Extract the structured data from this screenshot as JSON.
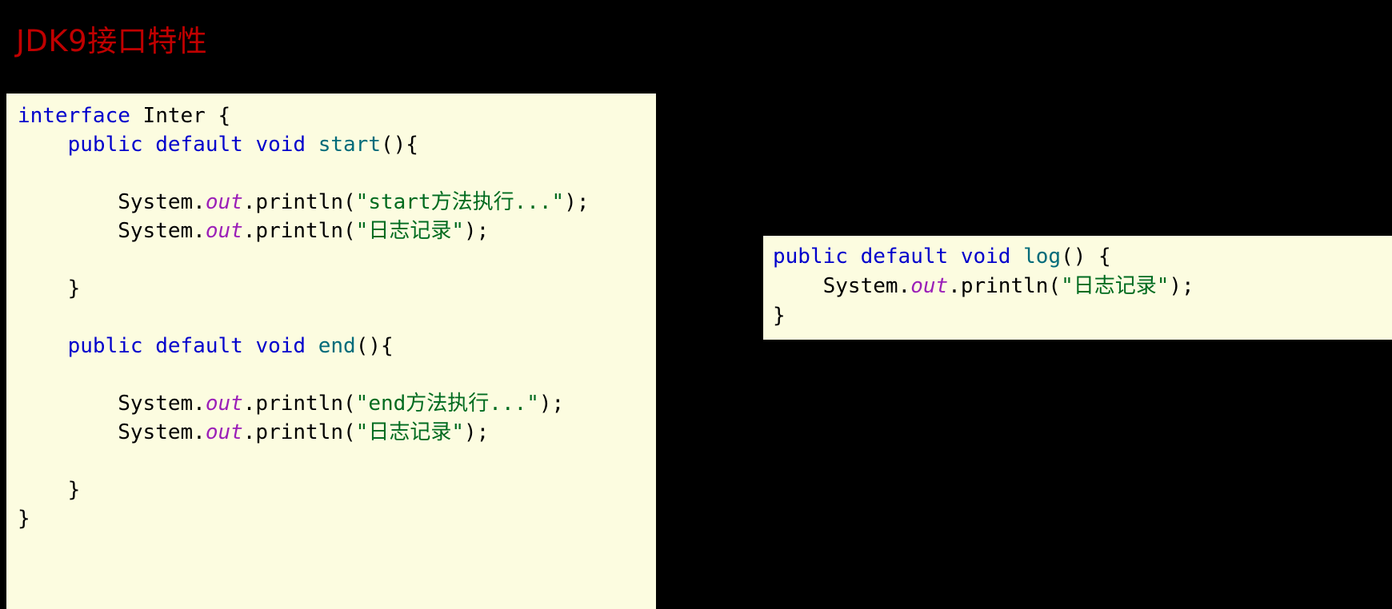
{
  "slide": {
    "title": "JDK9接口特性",
    "title_color": "#C00000",
    "background_color": "#000000"
  },
  "theme": {
    "code_background": "#FCFCE0",
    "keyword_color": "#0000CC",
    "method_color": "#006B7A",
    "field_color": "#9B1FB8",
    "string_color": "#006B1F",
    "plain_color": "#000000"
  },
  "code_main": {
    "name": "interface-inter-code-block",
    "lines": [
      {
        "id": "m1",
        "tokens": [
          {
            "t": "interface",
            "k": "kw"
          },
          {
            "t": " ",
            "k": "plain"
          },
          {
            "t": "Inter",
            "k": "plain"
          },
          {
            "t": " {",
            "k": "plain"
          }
        ]
      },
      {
        "id": "m2",
        "tokens": [
          {
            "t": "    ",
            "k": "plain"
          },
          {
            "t": "public",
            "k": "kw"
          },
          {
            "t": " ",
            "k": "plain"
          },
          {
            "t": "default",
            "k": "kw"
          },
          {
            "t": " ",
            "k": "plain"
          },
          {
            "t": "void",
            "k": "kw"
          },
          {
            "t": " ",
            "k": "plain"
          },
          {
            "t": "start",
            "k": "fn"
          },
          {
            "t": "(){",
            "k": "plain"
          }
        ]
      },
      {
        "id": "m3",
        "tokens": []
      },
      {
        "id": "m4",
        "tokens": [
          {
            "t": "        ",
            "k": "plain"
          },
          {
            "t": "System.",
            "k": "plain"
          },
          {
            "t": "out",
            "k": "field"
          },
          {
            "t": ".println(",
            "k": "plain"
          },
          {
            "t": "\"start方法执行...\"",
            "k": "str"
          },
          {
            "t": ");",
            "k": "plain"
          }
        ]
      },
      {
        "id": "m5",
        "tokens": [
          {
            "t": "        ",
            "k": "plain"
          },
          {
            "t": "System.",
            "k": "plain"
          },
          {
            "t": "out",
            "k": "field"
          },
          {
            "t": ".println(",
            "k": "plain"
          },
          {
            "t": "\"日志记录\"",
            "k": "str"
          },
          {
            "t": ");",
            "k": "plain"
          }
        ]
      },
      {
        "id": "m6",
        "tokens": []
      },
      {
        "id": "m7",
        "tokens": [
          {
            "t": "    }",
            "k": "plain"
          }
        ]
      },
      {
        "id": "m8",
        "tokens": []
      },
      {
        "id": "m9",
        "tokens": [
          {
            "t": "    ",
            "k": "plain"
          },
          {
            "t": "public",
            "k": "kw"
          },
          {
            "t": " ",
            "k": "plain"
          },
          {
            "t": "default",
            "k": "kw"
          },
          {
            "t": " ",
            "k": "plain"
          },
          {
            "t": "void",
            "k": "kw"
          },
          {
            "t": " ",
            "k": "plain"
          },
          {
            "t": "end",
            "k": "fn"
          },
          {
            "t": "(){",
            "k": "plain"
          }
        ]
      },
      {
        "id": "m10",
        "tokens": []
      },
      {
        "id": "m11",
        "tokens": [
          {
            "t": "        ",
            "k": "plain"
          },
          {
            "t": "System.",
            "k": "plain"
          },
          {
            "t": "out",
            "k": "field"
          },
          {
            "t": ".println(",
            "k": "plain"
          },
          {
            "t": "\"end方法执行...\"",
            "k": "str"
          },
          {
            "t": ");",
            "k": "plain"
          }
        ]
      },
      {
        "id": "m12",
        "tokens": [
          {
            "t": "        ",
            "k": "plain"
          },
          {
            "t": "System.",
            "k": "plain"
          },
          {
            "t": "out",
            "k": "field"
          },
          {
            "t": ".println(",
            "k": "plain"
          },
          {
            "t": "\"日志记录\"",
            "k": "str"
          },
          {
            "t": ");",
            "k": "plain"
          }
        ]
      },
      {
        "id": "m13",
        "tokens": []
      },
      {
        "id": "m14",
        "tokens": [
          {
            "t": "    }",
            "k": "plain"
          }
        ]
      },
      {
        "id": "m15",
        "tokens": [
          {
            "t": "}",
            "k": "plain"
          }
        ]
      }
    ],
    "plain_text": "interface Inter {\n    public default void start(){\n\n        System.out.println(\"start方法执行...\");\n        System.out.println(\"日志记录\");\n\n    }\n\n    public default void end(){\n\n        System.out.println(\"end方法执行...\");\n        System.out.println(\"日志记录\");\n\n    }\n}"
  },
  "code_aside": {
    "name": "log-default-method-code-block",
    "lines": [
      {
        "id": "a1",
        "tokens": [
          {
            "t": "public",
            "k": "kw"
          },
          {
            "t": " ",
            "k": "plain"
          },
          {
            "t": "default",
            "k": "kw"
          },
          {
            "t": " ",
            "k": "plain"
          },
          {
            "t": "void",
            "k": "kw"
          },
          {
            "t": " ",
            "k": "plain"
          },
          {
            "t": "log",
            "k": "fn"
          },
          {
            "t": "() {",
            "k": "plain"
          }
        ]
      },
      {
        "id": "a2",
        "tokens": [
          {
            "t": "    ",
            "k": "plain"
          },
          {
            "t": "System.",
            "k": "plain"
          },
          {
            "t": "out",
            "k": "field"
          },
          {
            "t": ".println(",
            "k": "plain"
          },
          {
            "t": "\"日志记录\"",
            "k": "str"
          },
          {
            "t": ");",
            "k": "plain"
          }
        ]
      },
      {
        "id": "a3",
        "tokens": [
          {
            "t": "}",
            "k": "plain"
          }
        ]
      }
    ],
    "plain_text": "public default void log() {\n    System.out.println(\"日志记录\");\n}"
  }
}
